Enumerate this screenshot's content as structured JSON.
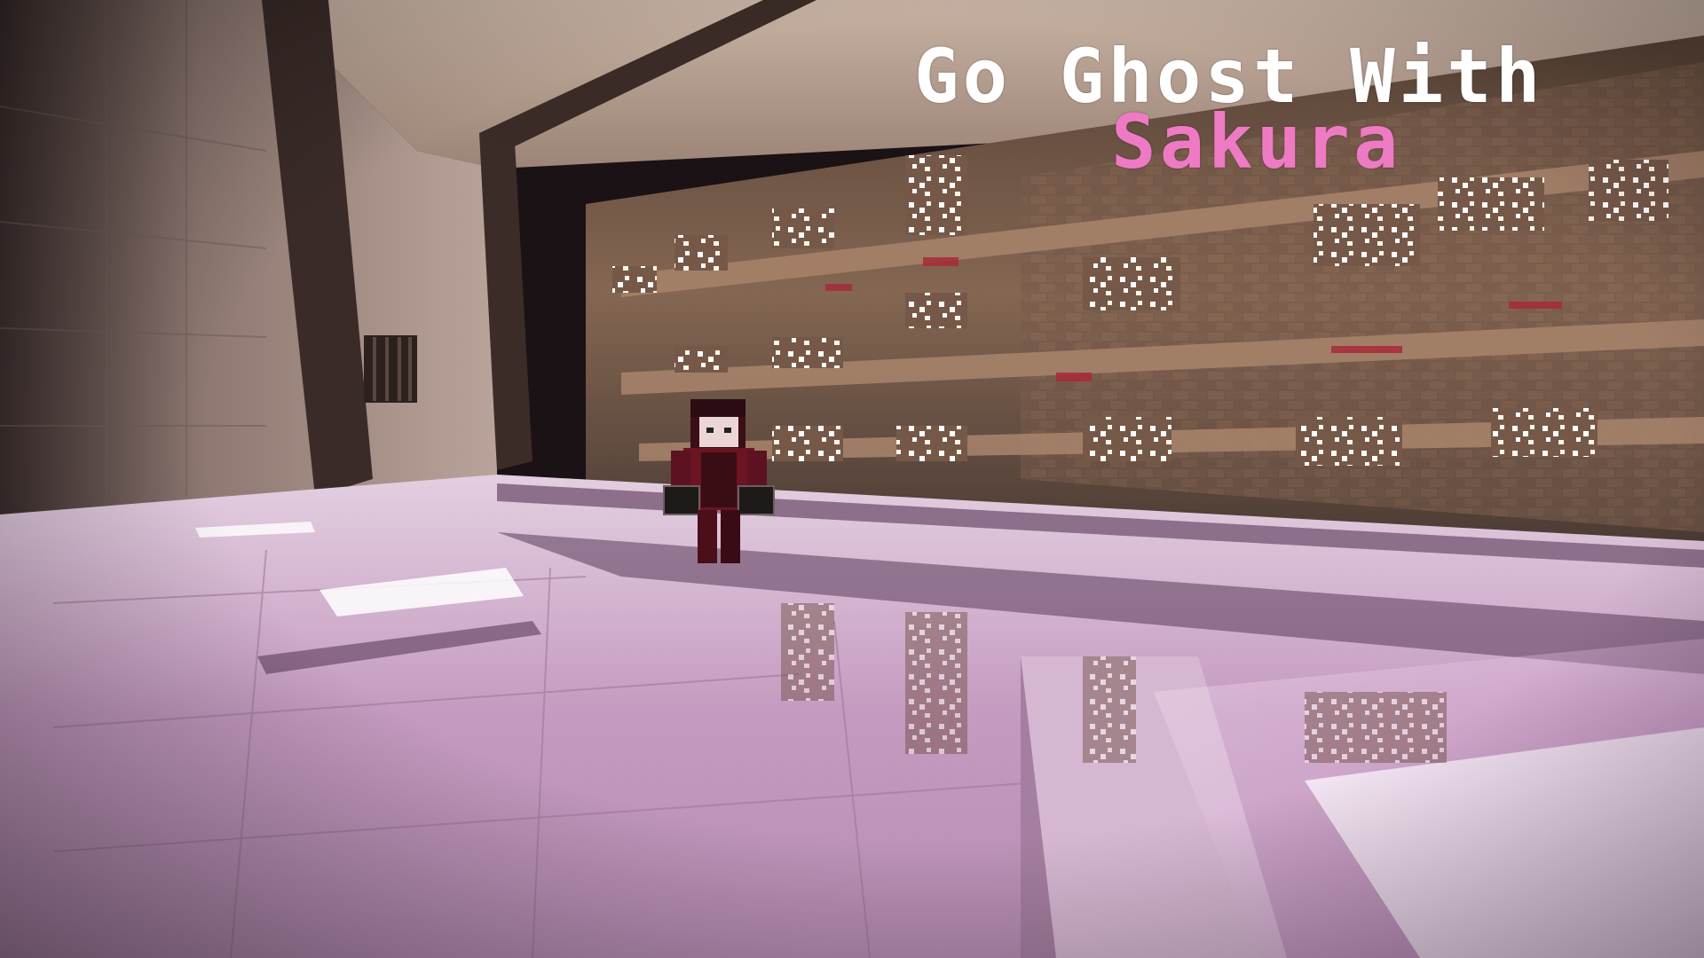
{
  "thumbnail": {
    "title_line_1": "Go Ghost With",
    "title_line_2": "Sakura"
  },
  "colors": {
    "title_primary": "#ffffff",
    "title_accent": "#ef7ac4",
    "floor_tint": "#c9a3c4",
    "wall_tint": "#8a6a5e",
    "light_block": "#fff4ea"
  }
}
